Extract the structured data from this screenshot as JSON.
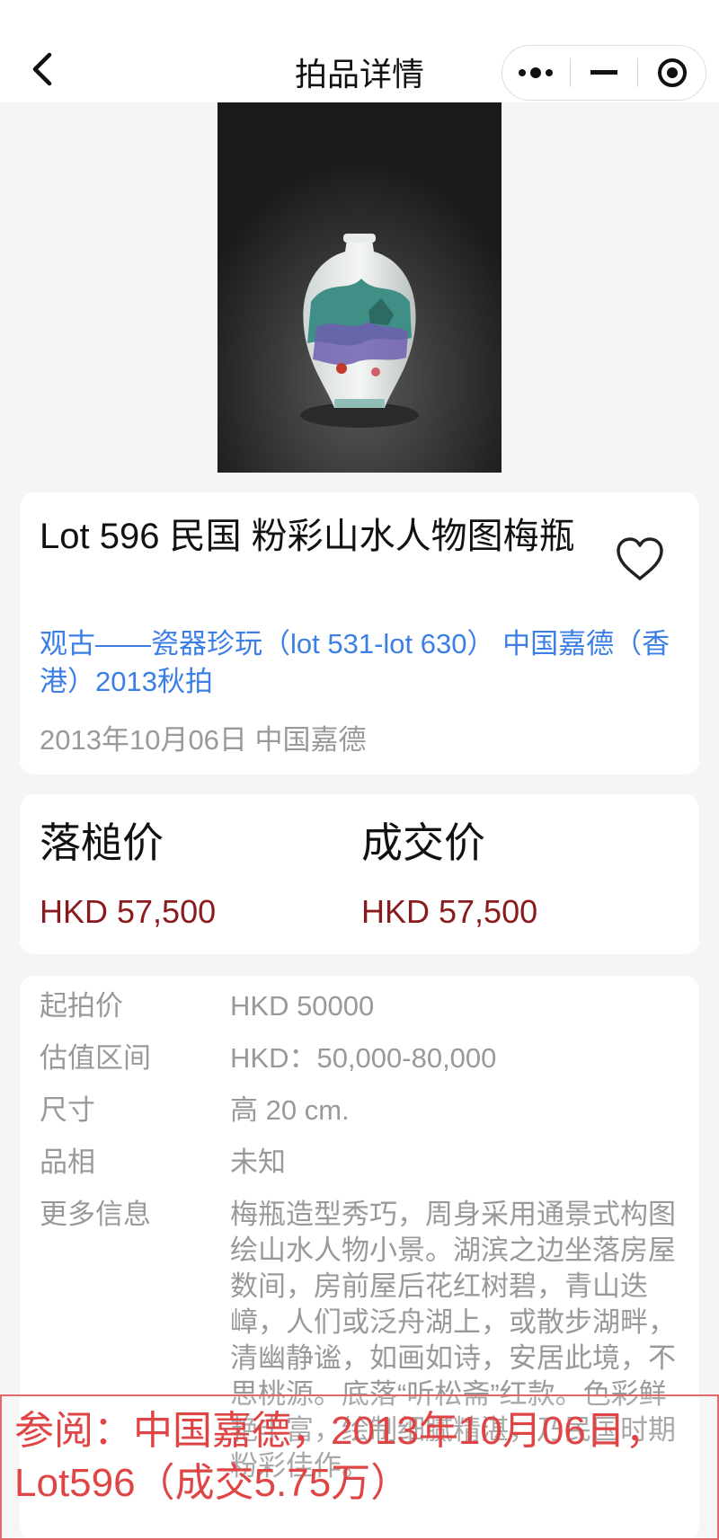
{
  "nav": {
    "title": "拍品详情"
  },
  "lot": {
    "title": "Lot 596 民国 粉彩山水人物图梅瓶",
    "session": "观古——瓷器珍玩（lot 531-lot 630） 中国嘉德（香港）2013秋拍",
    "date_house": "2013年10月06日 中国嘉德"
  },
  "prices": {
    "hammer_label": "落槌价",
    "hammer_value": "HKD 57,500",
    "deal_label": "成交价",
    "deal_value": "HKD 57,500"
  },
  "info": [
    {
      "key": "起拍价",
      "value": "HKD 50000"
    },
    {
      "key": "估值区间",
      "value": "HKD：50,000-80,000"
    },
    {
      "key": "尺寸",
      "value": "高 20 cm."
    },
    {
      "key": "品相",
      "value": "未知"
    },
    {
      "key": "更多信息",
      "value": "梅瓶造型秀巧，周身采用通景式构图绘山水人物小景。湖滨之边坐落房屋数间，房前屋后花红树碧，青山迭嶂，人们或泛舟湖上，或散步湖畔，清幽静谧，如画如诗，安居此境，不思桃源。底落“听松斋”红款。色彩鲜艳丰富，绘制细腻精湛，乃民国时期粉彩佳作。"
    }
  ],
  "watermark": {
    "text": "参阅：中国嘉德，2013年10月06日，Lot596（成交5.75万）"
  },
  "colors": {
    "link": "#3b7fe6",
    "price": "#8b1a1f",
    "muted": "#999999",
    "watermark": "#e04545"
  }
}
